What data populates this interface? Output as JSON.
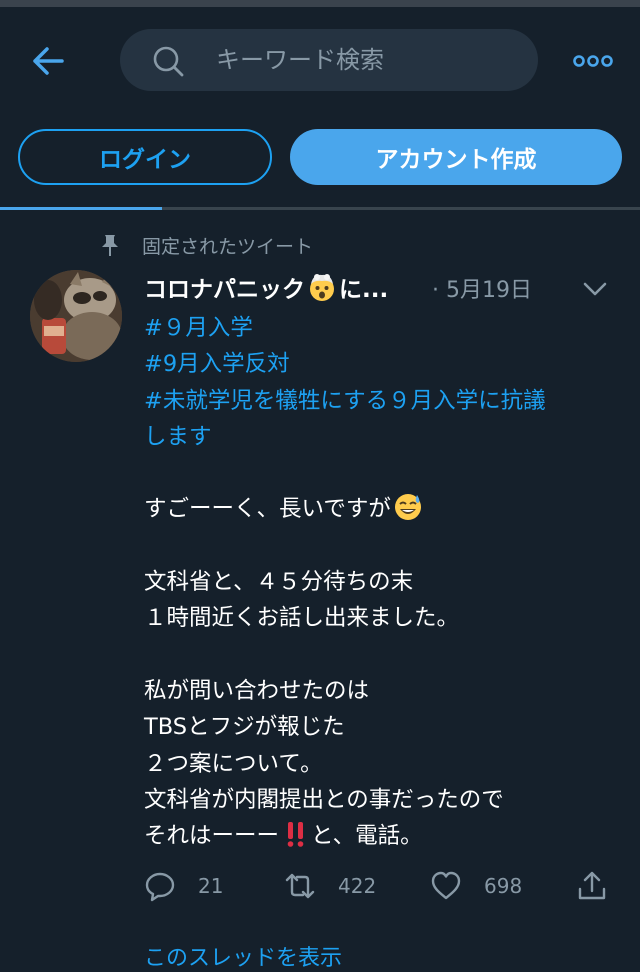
{
  "header": {
    "search_placeholder": "キーワード検索"
  },
  "auth": {
    "login_label": "ログイン",
    "signup_label": "アカウント作成"
  },
  "tweet": {
    "pinned_label": "固定されたツイート",
    "author_prefix": "コロナパニック",
    "author_suffix": "に...",
    "meta": "· 5月19日",
    "hashtags": [
      "#９月入学",
      "#9月入学反対",
      "#未就学児を犠牲にする９月入学に抗議",
      "します"
    ],
    "lines": {
      "l1": "すごーーく、長いですが",
      "l2": "文科省と、４５分待ちの末",
      "l3": "１時間近くお話し出来ました。",
      "l4": "私が問い合わせたのは",
      "l5": "TBSとフジが報じた",
      "l6": "２つ案について。",
      "l7": "文科省が内閣提出との事だったので",
      "l8_pre": "それはーーー",
      "l8_post": "と、電話。"
    },
    "stats": {
      "replies": "21",
      "retweets": "422",
      "likes": "698"
    },
    "thread_link": "このスレッドを表示"
  },
  "icons": {
    "back": "arrow-left-icon",
    "search": "search-icon",
    "more": "more-dots-icon",
    "pin": "pin-icon",
    "caret": "chevron-down-icon",
    "reply": "reply-icon",
    "retweet": "retweet-icon",
    "like": "heart-icon",
    "share": "share-icon",
    "exploding_head": "exploding-head-emoji",
    "sweat_smile": "sweat-smile-emoji",
    "double_exclamation": "double-exclamation-emoji"
  },
  "colors": {
    "background": "#15202b",
    "accent": "#1da1f2",
    "muted": "#8899a6",
    "search_bg": "#253341"
  }
}
